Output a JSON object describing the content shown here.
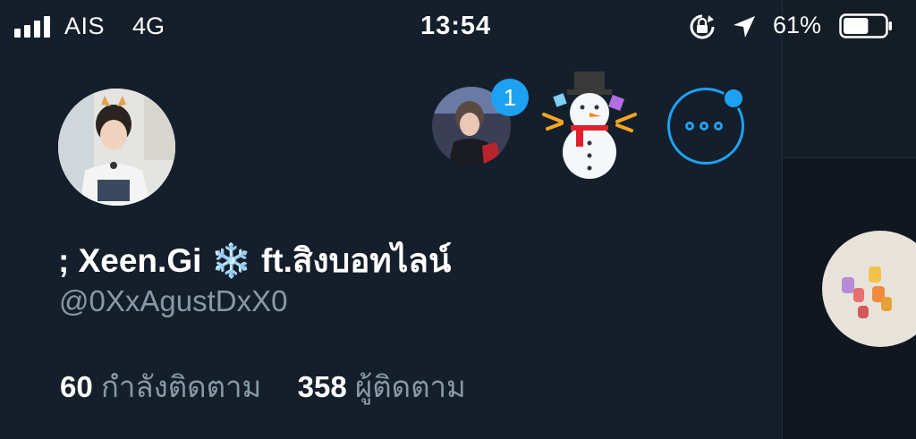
{
  "status_bar": {
    "carrier": "AIS",
    "network": "4G",
    "time": "13:54",
    "battery_percent": "61%",
    "battery_level": 0.61,
    "icons": [
      "signal-icon",
      "orientation-lock-icon",
      "location-arrow-icon",
      "battery-icon"
    ]
  },
  "account_switcher": {
    "notification_count": "1",
    "more_label": "more-options-icon"
  },
  "profile": {
    "display_name": "; Xeen.Gi",
    "display_name_emoji": "❄️",
    "display_name_suffix": "ft.สิงบอทไลน์",
    "handle": "@0XxAgustDxX0",
    "following_count": "60",
    "following_label": "กำลังติดตาม",
    "followers_count": "358",
    "followers_label": "ผู้ติดตาม"
  },
  "colors": {
    "accent": "#1da1f2",
    "background": "#151f2b",
    "secondary_text": "#8899a6"
  }
}
